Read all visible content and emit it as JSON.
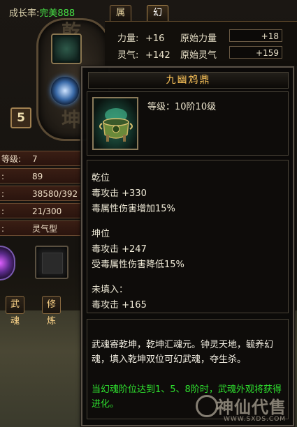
{
  "growth": {
    "label": "成长率:",
    "value": "完美888"
  },
  "left": {
    "glyph_top": "乾",
    "glyph_bottom": "坤",
    "level_badge": "5",
    "stats": [
      {
        "key": "等级:",
        "value": "7"
      },
      {
        "key": ":",
        "value": "89"
      },
      {
        "key": ":",
        "value": "38580/392"
      },
      {
        "key": ":",
        "value": "21/300"
      },
      {
        "key": ":",
        "value": "灵气型"
      }
    ],
    "bottom_tabs": [
      "武魂",
      "修炼"
    ]
  },
  "right": {
    "tabs": [
      "属性",
      "幻魂"
    ],
    "rows": [
      {
        "name": "力量:",
        "add": "+16",
        "base_label": "原始力量",
        "box": "+18"
      },
      {
        "name": "灵气:",
        "add": "+142",
        "base_label": "原始灵气",
        "box": "+159"
      }
    ]
  },
  "tooltip": {
    "title": "九幽鸩鼎",
    "level": "等级：10阶10级",
    "sections": [
      {
        "heading": "乾位",
        "lines": [
          "毒攻击 +330",
          "毒属性伤害增加15%"
        ]
      },
      {
        "heading": "坤位",
        "lines": [
          "毒攻击 +247",
          "受毒属性伤害降低15%"
        ]
      },
      {
        "heading": "未填入：",
        "lines": [
          "毒攻击 +165"
        ]
      }
    ],
    "description": "武魂寄乾坤，乾坤汇魂元。钟灵天地，毓养幻魂，填入乾坤双位可幻武魂，夺生杀。",
    "description_green": "当幻魂阶位达到1、5、8阶时，武魂外观将获得进化。"
  },
  "watermark": {
    "text": "神仙代售",
    "url": "WWW.SXDS.COM"
  }
}
